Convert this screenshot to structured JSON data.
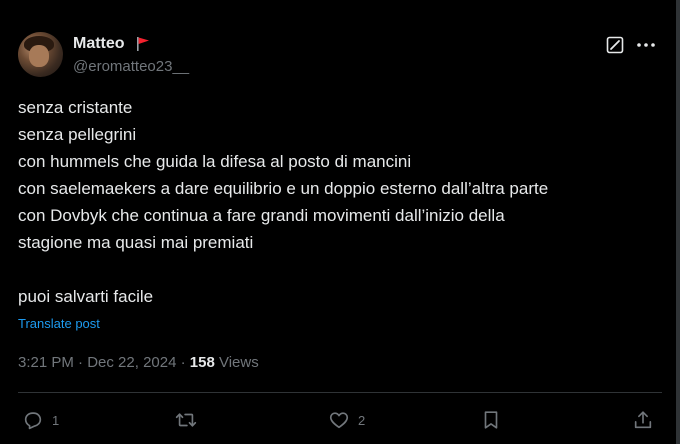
{
  "author": {
    "display_name": "Matteo",
    "handle": "@eromatteo23__"
  },
  "tweet": {
    "lines": [
      "senza cristante",
      "senza pellegrini",
      "con hummels che guida la difesa al posto di mancini",
      "con saelemaekers a dare equilibrio e un doppio esterno dall’altra parte",
      "con Dovbyk che continua a fare grandi movimenti dall’inizio della",
      "stagione ma quasi mai premiati",
      "",
      "puoi salvarti facile"
    ],
    "translate_label": "Translate post"
  },
  "meta": {
    "time": "3:21 PM",
    "separator": " · ",
    "date": "Dec 22, 2024",
    "views_count": "158",
    "views_label": " Views"
  },
  "actions": {
    "reply_count": "1",
    "like_count": "2"
  },
  "colors": {
    "background": "#000000",
    "text": "#e7e9ea",
    "muted": "#71767b",
    "link": "#1d9bf0",
    "flag": "#f4212e"
  },
  "icons": [
    "flag-icon",
    "grok-icon",
    "more-icon",
    "reply-icon",
    "repost-icon",
    "like-icon",
    "bookmark-icon",
    "share-icon"
  ]
}
